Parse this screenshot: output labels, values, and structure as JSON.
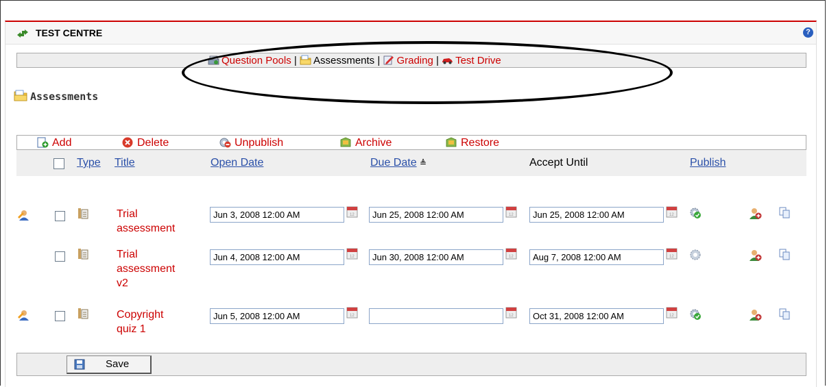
{
  "portlet": {
    "title": "TEST CENTRE",
    "help": "?"
  },
  "nav": {
    "items": [
      {
        "label": "Question Pools",
        "icon": "question-pools-icon",
        "current": false
      },
      {
        "label": "Assessments",
        "icon": "folder-icon",
        "current": true
      },
      {
        "label": "Grading",
        "icon": "grading-icon",
        "current": false
      },
      {
        "label": "Test Drive",
        "icon": "car-icon",
        "current": false
      }
    ],
    "separator": "|"
  },
  "heading": "Assessments",
  "toolbar": {
    "add": "Add",
    "delete": "Delete",
    "unpublish": "Unpublish",
    "archive": "Archive",
    "restore": "Restore"
  },
  "columns": {
    "type": "Type",
    "title": "Title",
    "open_date": "Open Date",
    "due_date": "Due Date",
    "sort_indicator": "≜",
    "accept_until": "Accept Until",
    "publish": "Publish"
  },
  "rows": [
    {
      "title_line1": "Trial",
      "title_line2": "assessment",
      "title_line3": "",
      "open": "Jun 3, 2008 12:00 AM",
      "due": "Jun 25, 2008 12:00 AM",
      "accept": "Jun 25, 2008 12:00 AM",
      "published": true,
      "has_user": true
    },
    {
      "title_line1": "Trial",
      "title_line2": "assessment",
      "title_line3": "v2",
      "open": "Jun 4, 2008 12:00 AM",
      "due": "Jun 30, 2008 12:00 AM",
      "accept": "Aug 7, 2008 12:00 AM",
      "published": false,
      "has_user": false
    },
    {
      "title_line1": "Copyright",
      "title_line2": "quiz 1",
      "title_line3": "",
      "open": "Jun 5, 2008 12:00 AM",
      "due": "",
      "accept": "Oct 31, 2008 12:00 AM",
      "published": true,
      "has_user": true
    }
  ],
  "footer": {
    "save": "Save"
  },
  "colors": {
    "accent_red": "#cc0000",
    "link_blue": "#2a4fa8",
    "bar_gray": "#eeeeee"
  }
}
